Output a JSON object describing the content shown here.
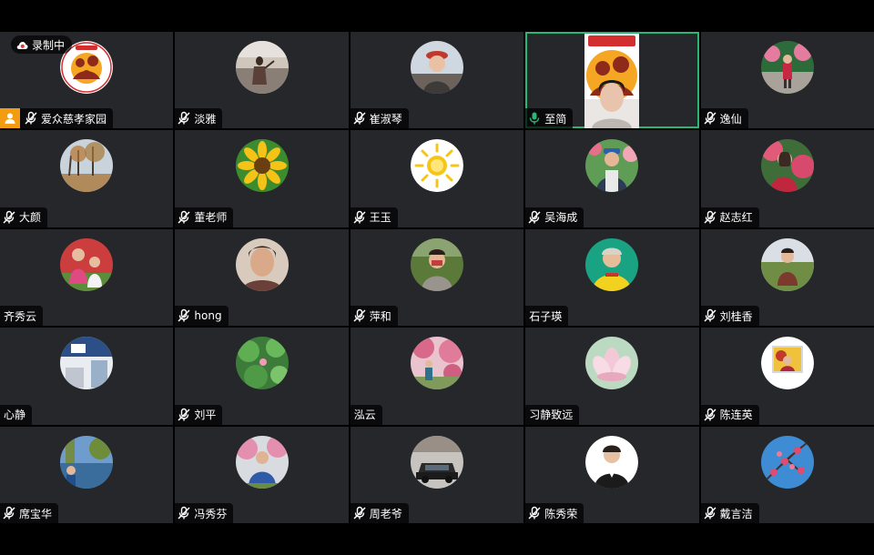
{
  "recording": {
    "label": "录制中"
  },
  "colors": {
    "active_border": "#2bb673",
    "tile_bg": "#25272b",
    "mic_muted": "#ffffff",
    "mic_on": "#2bb673",
    "host_badge": "#f39c12"
  },
  "participants": [
    {
      "name": "爱众慈孝家园",
      "mic": "muted",
      "host": true,
      "avatar": "logo"
    },
    {
      "name": "淡雅",
      "mic": "muted",
      "avatar": "photo-dancer"
    },
    {
      "name": "崔淑琴",
      "mic": "muted",
      "avatar": "photo-woman-hat"
    },
    {
      "name": "至简",
      "mic": "on",
      "active": true,
      "avatar": "video-woman"
    },
    {
      "name": "逸仙",
      "mic": "muted",
      "avatar": "photo-flowers-woman"
    },
    {
      "name": "大颜",
      "mic": "muted",
      "avatar": "photo-autumn-trees"
    },
    {
      "name": "董老师",
      "mic": "muted",
      "avatar": "photo-sunflower"
    },
    {
      "name": "王玉",
      "mic": "muted",
      "avatar": "sun-icon"
    },
    {
      "name": "吴海成",
      "mic": "muted",
      "avatar": "photo-man-cap"
    },
    {
      "name": "赵志红",
      "mic": "muted",
      "avatar": "photo-woman-blossoms"
    },
    {
      "name": "齐秀云",
      "mic": "none",
      "avatar": "photo-two-kids"
    },
    {
      "name": "hong",
      "mic": "muted",
      "avatar": "photo-woman-face"
    },
    {
      "name": "萍和",
      "mic": "muted",
      "avatar": "photo-woman-field"
    },
    {
      "name": "石子瑛",
      "mic": "none",
      "avatar": "photo-woman-yellow"
    },
    {
      "name": "刘桂香",
      "mic": "muted",
      "avatar": "photo-woman-grass"
    },
    {
      "name": "心静",
      "mic": "none",
      "avatar": "photo-room"
    },
    {
      "name": "刘平",
      "mic": "muted",
      "avatar": "photo-lotus-leaves"
    },
    {
      "name": "泓云",
      "mic": "none",
      "avatar": "photo-pink-tree"
    },
    {
      "name": "习静致远",
      "mic": "none",
      "avatar": "photo-lotus"
    },
    {
      "name": "陈连英",
      "mic": "muted",
      "avatar": "photo-portrait-frame"
    },
    {
      "name": "席宝华",
      "mic": "muted",
      "avatar": "photo-lake"
    },
    {
      "name": "冯秀芬",
      "mic": "muted",
      "avatar": "photo-man-blossoms"
    },
    {
      "name": "周老爷",
      "mic": "muted",
      "avatar": "photo-car"
    },
    {
      "name": "陈秀荣",
      "mic": "muted",
      "avatar": "photo-woman-suit"
    },
    {
      "name": "戴言洁",
      "mic": "muted",
      "avatar": "photo-plum-blossoms"
    }
  ]
}
